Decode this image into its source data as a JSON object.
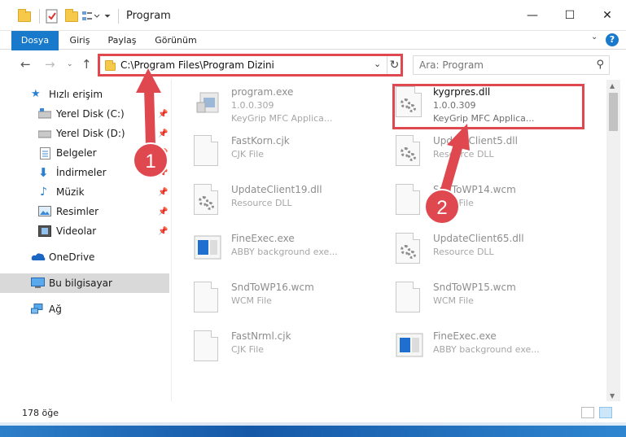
{
  "window": {
    "title": "Program",
    "minimize": "—",
    "maximize": "☐",
    "close": "✕"
  },
  "ribbon": {
    "tabs": [
      "Dosya",
      "Giriş",
      "Paylaş",
      "Görünüm"
    ],
    "help": "?"
  },
  "address": {
    "path": "C:\\Program Files\\Program Dizini"
  },
  "search": {
    "placeholder": "Ara: Program"
  },
  "sidebar": {
    "items": [
      {
        "label": "Hızlı erişim",
        "icon": "star-icon"
      },
      {
        "label": "Yerel Disk (C:)",
        "icon": "drive-icon",
        "pinned": true
      },
      {
        "label": "Yerel Disk (D:)",
        "icon": "drive-icon",
        "pinned": true
      },
      {
        "label": "Belgeler",
        "icon": "documents-icon",
        "pinned": true
      },
      {
        "label": "İndirmeler",
        "icon": "downloads-icon",
        "pinned": true
      },
      {
        "label": "Müzik",
        "icon": "music-icon",
        "pinned": true
      },
      {
        "label": "Resimler",
        "icon": "pictures-icon",
        "pinned": true
      },
      {
        "label": "Videolar",
        "icon": "videos-icon",
        "pinned": true
      },
      {
        "label": "OneDrive",
        "icon": "onedrive-icon"
      },
      {
        "label": "Bu bilgisayar",
        "icon": "computer-icon",
        "selected": true
      },
      {
        "label": "Ağ",
        "icon": "network-icon"
      }
    ]
  },
  "files": [
    {
      "name": "program.exe",
      "line1": "1.0.0.309",
      "line2": "KeyGrip MFC Applica...",
      "icon": "exe-icon"
    },
    {
      "name": "kygrpres.dll",
      "line1": "1.0.0.309",
      "line2": "KeyGrip MFC Applica...",
      "icon": "gear-icon",
      "highlight": true
    },
    {
      "name": "FastKorn.cjk",
      "line1": "CJK File",
      "icon": "document-icon"
    },
    {
      "name": "UpdateClient5.dll",
      "line1": "Resource DLL",
      "icon": "gear-icon"
    },
    {
      "name": "UpdateClient19.dll",
      "line1": "Resource DLL",
      "icon": "gear-icon"
    },
    {
      "name": "SndToWP14.wcm",
      "line1": "WCM File",
      "icon": "document-icon"
    },
    {
      "name": "FineExec.exe",
      "line1": "ABBY background exe...",
      "icon": "app-window-icon"
    },
    {
      "name": "UpdateClient65.dll",
      "line1": "Resource DLL",
      "icon": "gear-icon"
    },
    {
      "name": "SndToWP16.wcm",
      "line1": "WCM File",
      "icon": "document-icon"
    },
    {
      "name": "SndToWP15.wcm",
      "line1": "WCM File",
      "icon": "document-icon"
    },
    {
      "name": "FastNrml.cjk",
      "line1": "CJK File",
      "icon": "document-icon"
    },
    {
      "name": "FineExec.exe",
      "line1": "ABBY background exe...",
      "icon": "app-window-icon"
    }
  ],
  "annotations": {
    "step1": "1",
    "step2": "2",
    "color": "#e0484f"
  },
  "status": {
    "count": "178 öğe"
  }
}
